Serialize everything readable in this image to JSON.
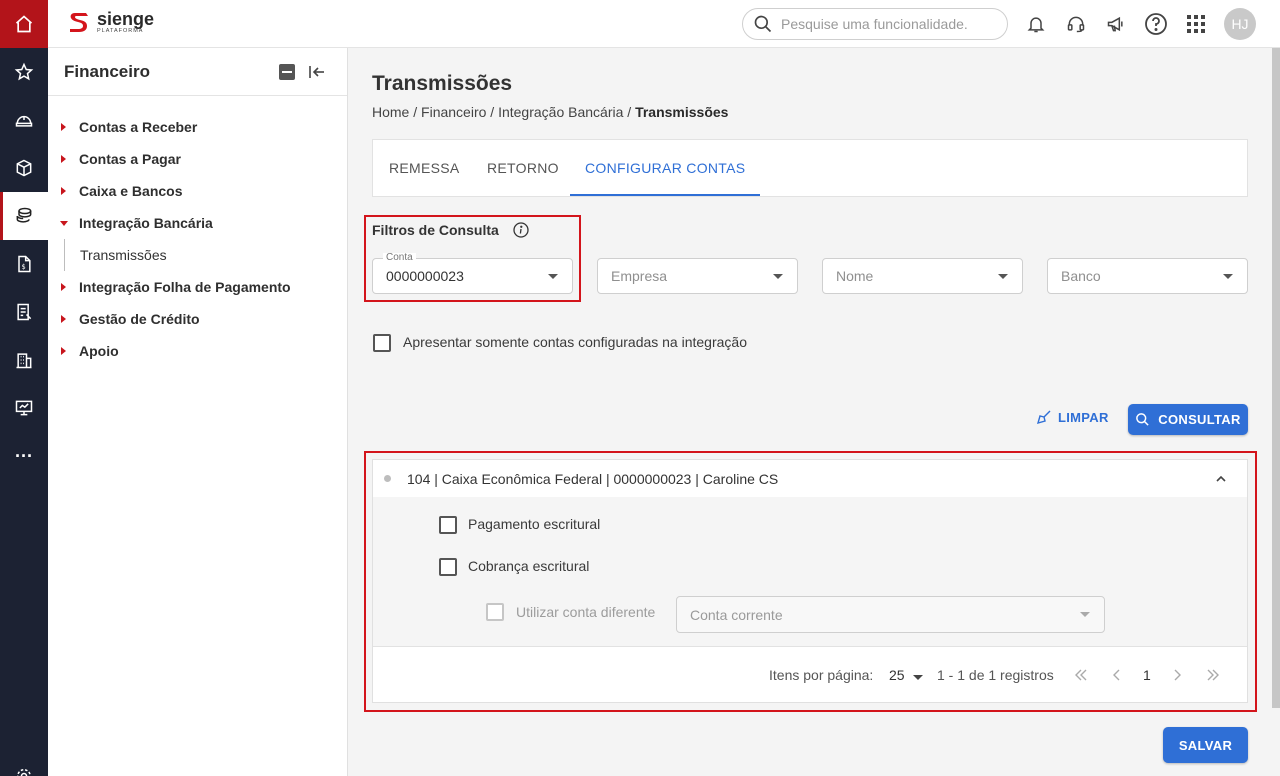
{
  "app": {
    "brand": "sienge",
    "brand_sub": "PLATAFORMA",
    "accent": "#b3141a",
    "primary": "#2f6fd6"
  },
  "topbar": {
    "search_placeholder": "Pesquise uma funcionalidade.",
    "icons": [
      "bell-icon",
      "headset-icon",
      "megaphone-icon",
      "help-icon",
      "apps-grid-icon"
    ],
    "avatar_initials": "HJ"
  },
  "rail": {
    "icons": [
      "home-icon",
      "star-icon",
      "helmet-icon",
      "box-icon",
      "coins-icon",
      "document-icon",
      "list-icon",
      "building-icon",
      "monitor-icon",
      "more-icon",
      "settings-icon"
    ],
    "more_label": "···"
  },
  "sidebar": {
    "title": "Financeiro",
    "items": [
      {
        "label": "Contas a Receber"
      },
      {
        "label": "Contas a Pagar"
      },
      {
        "label": "Caixa e Bancos"
      },
      {
        "label": "Integração Bancária"
      },
      {
        "label": "Transmissões"
      },
      {
        "label": "Integração Folha de Pagamento"
      },
      {
        "label": "Gestão de Crédito"
      },
      {
        "label": "Apoio"
      }
    ]
  },
  "page": {
    "title": "Transmissões",
    "breadcrumb": [
      "Home",
      "Financeiro",
      "Integração Bancária",
      "Transmissões"
    ],
    "separator": " / "
  },
  "tabs": [
    {
      "label": "REMESSA"
    },
    {
      "label": "RETORNO"
    },
    {
      "label": "CONFIGURAR CONTAS"
    }
  ],
  "filters": {
    "title": "Filtros de Consulta",
    "conta_label": "Conta",
    "conta_value": "0000000023",
    "empresa_placeholder": "Empresa",
    "nome_placeholder": "Nome",
    "banco_placeholder": "Banco",
    "only_configured_label": "Apresentar somente contas configuradas na integração",
    "clear_label": "LIMPAR",
    "search_label": "CONSULTAR"
  },
  "account": {
    "title": "104 | Caixa Econômica Federal | 0000000023 | Caroline CS",
    "options": [
      {
        "label": "Pagamento escritural"
      },
      {
        "label": "Cobrança escritural"
      }
    ],
    "use_other_label": "Utilizar conta diferente",
    "conta_corrente_placeholder": "Conta corrente"
  },
  "pagination": {
    "items_per_page_label": "Itens por página:",
    "items_per_page": "25",
    "range": "1 - 1 de 1 registros",
    "current_page": "1"
  },
  "save_label": "SALVAR"
}
